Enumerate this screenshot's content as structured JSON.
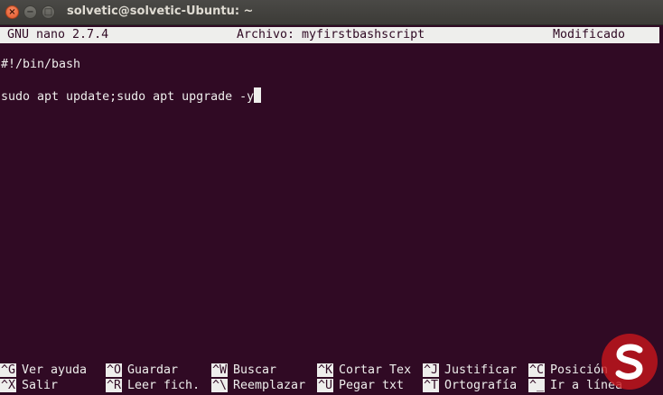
{
  "window": {
    "title": "solvetic@solvetic-Ubuntu: ~",
    "close_glyph": "×",
    "minimize_glyph": "−",
    "maximize_glyph": "□"
  },
  "nano": {
    "version": "GNU nano 2.7.4",
    "file": "Archivo: myfirstbashscript",
    "status": "Modificado"
  },
  "editor": {
    "lines": [
      "#!/bin/bash",
      "sudo apt update;sudo apt upgrade -y"
    ]
  },
  "shortcuts": {
    "row1": [
      {
        "key": "^G",
        "label": "Ver ayuda"
      },
      {
        "key": "^O",
        "label": "Guardar"
      },
      {
        "key": "^W",
        "label": "Buscar"
      },
      {
        "key": "^K",
        "label": "Cortar Tex"
      },
      {
        "key": "^J",
        "label": "Justificar"
      },
      {
        "key": "^C",
        "label": "Posición"
      }
    ],
    "row2": [
      {
        "key": "^X",
        "label": "Salir"
      },
      {
        "key": "^R",
        "label": "Leer fich."
      },
      {
        "key": "^\\",
        "label": "Reemplazar"
      },
      {
        "key": "^U",
        "label": "Pegar txt"
      },
      {
        "key": "^T",
        "label": "Ortografía"
      },
      {
        "key": "^_",
        "label": "Ir a línea"
      }
    ]
  },
  "colors": {
    "terminal_background": "#300a24",
    "terminal_foreground": "#eeeeec",
    "titlebar": "#3c3b37",
    "close_button": "#e2572b",
    "watermark": "#c8151c"
  },
  "watermark": {
    "icon": "solvetic-logo-icon"
  }
}
